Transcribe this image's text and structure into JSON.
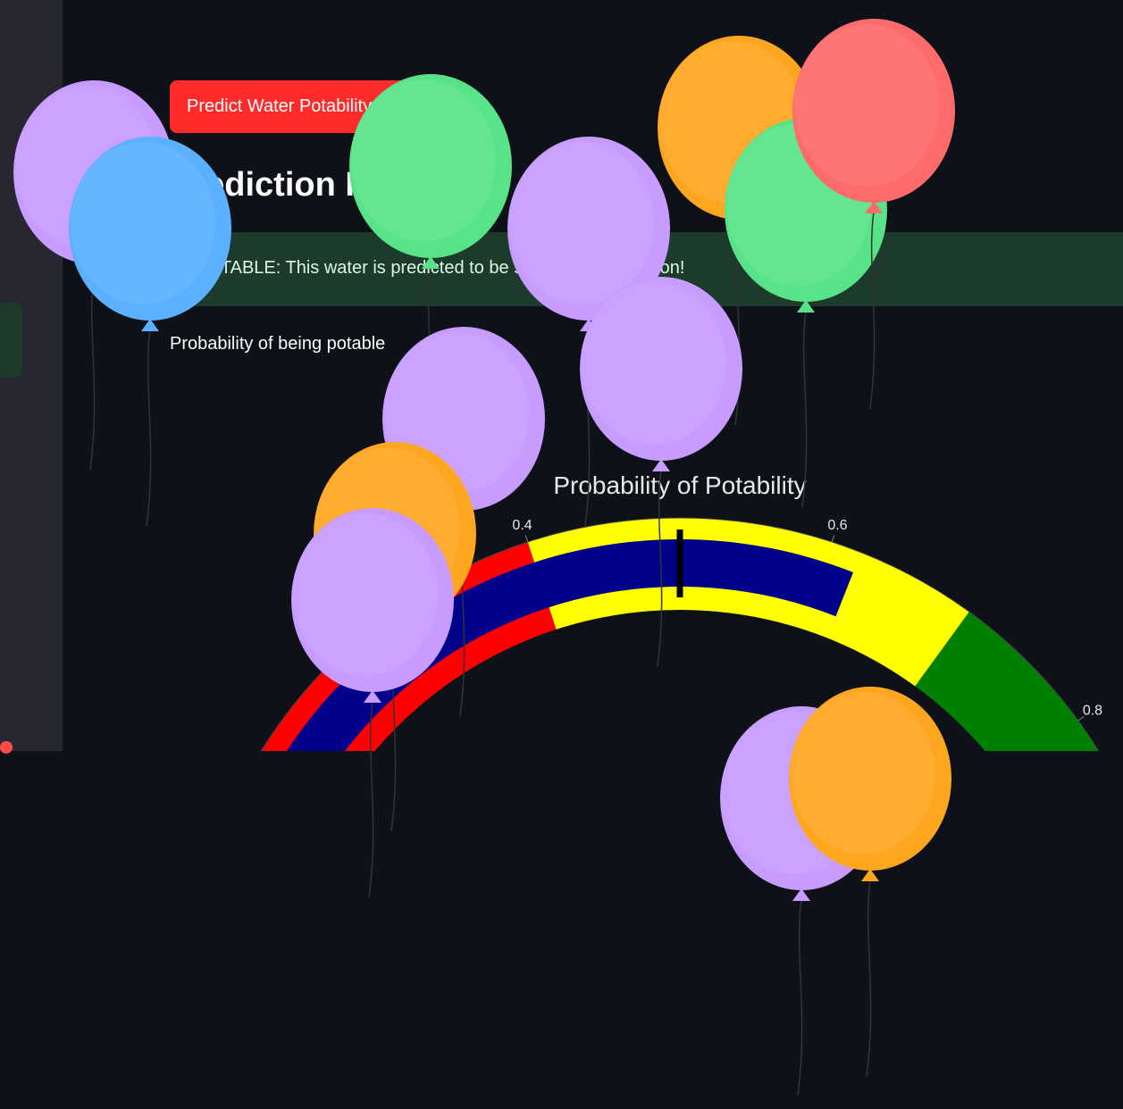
{
  "sidebar": {},
  "main": {
    "predict_button_label": "Predict Water Potability",
    "result_heading": "Prediction Result",
    "success_message": "POTABLE: This water is predicted to be safe for consumption!",
    "probability_text": "Probability of being potable"
  },
  "chart_data": {
    "type": "gauge",
    "title": "Probability of Potability",
    "value": 0.62,
    "threshold": 0.5,
    "range": [
      0,
      1
    ],
    "tick_labels": [
      "0.4",
      "0.6",
      "0.8"
    ],
    "ticks": [
      0.4,
      0.6,
      0.8
    ],
    "steps": [
      {
        "range": [
          0,
          0.4
        ],
        "color": "#ff0000"
      },
      {
        "range": [
          0.4,
          0.7
        ],
        "color": "#ffff00"
      },
      {
        "range": [
          0.7,
          1
        ],
        "color": "#008000"
      }
    ],
    "bar_color": "#00008b",
    "threshold_color": "#000000"
  },
  "balloon_colors": {
    "purple": "#c79bff",
    "blue": "#5bb1ff",
    "green": "#59e388",
    "orange": "#ffa621",
    "red": "#ff6b6b"
  }
}
